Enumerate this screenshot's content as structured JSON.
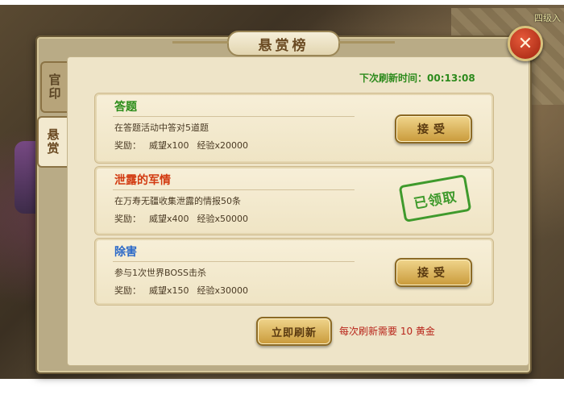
{
  "corner_text": "四级入",
  "panel": {
    "title": "悬赏榜",
    "close_icon": "✕"
  },
  "side_tabs": [
    {
      "label": "官印"
    },
    {
      "label": "悬赏"
    }
  ],
  "refresh_timer": {
    "label": "下次刷新时间：",
    "time": "00:13:08"
  },
  "quests": [
    {
      "title": "答题",
      "title_color": "#2a8c18",
      "desc": "在答题活动中答对5道题",
      "reward_label": "奖励：",
      "reward_fame": "威望x100",
      "reward_exp": "经验x20000",
      "action": "接受"
    },
    {
      "title": "泄露的军情",
      "title_color": "#d23a10",
      "desc": "在万寿无疆收集泄露的情报50条",
      "reward_label": "奖励：",
      "reward_fame": "威望x400",
      "reward_exp": "经验x50000",
      "stamp": "已领取"
    },
    {
      "title": "除害",
      "title_color": "#2a68c8",
      "desc": "参与1次世界BOSS击杀",
      "reward_label": "奖励：",
      "reward_fame": "威望x150",
      "reward_exp": "经验x30000",
      "action": "接受"
    }
  ],
  "footer": {
    "refresh_button": "立即刷新",
    "refresh_note": "每次刷新需要 10 黄金"
  }
}
